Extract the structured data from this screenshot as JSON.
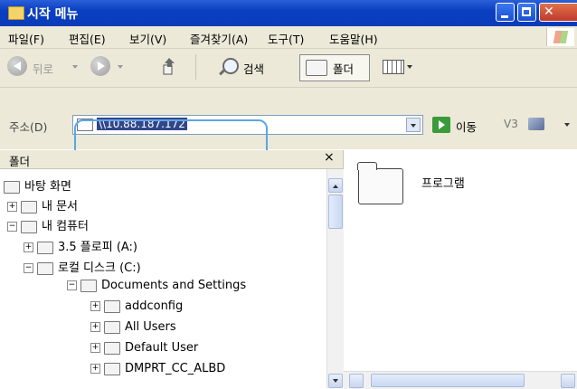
{
  "window": {
    "title": "시작 메뉴"
  },
  "menu": [
    "파일(F)",
    "편집(E)",
    "보기(V)",
    "즐겨찾기(A)",
    "도구(T)",
    "도움말(H)"
  ],
  "toolbar": {
    "back": "뒤로",
    "search": "검색",
    "folders": "폴더"
  },
  "address": {
    "label": "주소(D)",
    "value": "\\\\10.88.187.172",
    "go": "이동",
    "extra": "V3"
  },
  "pane": {
    "title": "폴더",
    "close": "×"
  },
  "tree": [
    {
      "label": "바탕 화면",
      "pm": "",
      "icon": "desktop-icon"
    },
    {
      "label": "내 문서",
      "pm": "+",
      "icon": "my-documents-icon"
    },
    {
      "label": "내 컴퓨터",
      "pm": "−",
      "icon": "my-computer-icon"
    },
    {
      "label": "3.5 플로피 (A:)",
      "pm": "+",
      "icon": "floppy-icon"
    },
    {
      "label": "로컬 디스크 (C:)",
      "pm": "−",
      "icon": "local-disk-icon"
    },
    {
      "label": "Documents and Settings",
      "pm": "−",
      "icon": "folder-icon"
    },
    {
      "label": "addconfig",
      "pm": "+",
      "icon": "folder-icon"
    },
    {
      "label": "All Users",
      "pm": "+",
      "icon": "folder-icon"
    },
    {
      "label": "Default User",
      "pm": "+",
      "icon": "folder-icon"
    },
    {
      "label": "DMPRT_CC_ALBD",
      "pm": "+",
      "icon": "folder-icon"
    }
  ],
  "content": {
    "items": [
      {
        "label": "프로그램"
      }
    ]
  }
}
